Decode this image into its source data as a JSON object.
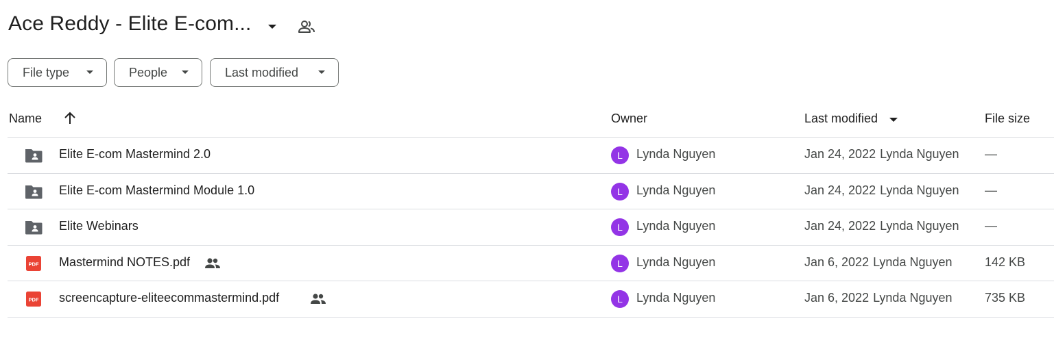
{
  "header": {
    "title": "Ace Reddy - Elite E-com...",
    "title_caret_icon": "caret-down-icon",
    "share_icon": "people-outline-icon"
  },
  "filters": [
    {
      "label": "File type"
    },
    {
      "label": "People"
    },
    {
      "label": "Last modified"
    }
  ],
  "columns": {
    "name": "Name",
    "owner": "Owner",
    "last_modified": "Last modified",
    "file_size": "File size",
    "sort_icon": "arrow-up-icon"
  },
  "colors": {
    "avatar_bg": "#9334e6",
    "folder_icon": "#5f6368",
    "pdf_icon": "#ea4335",
    "divider": "#dadce0"
  },
  "rows": [
    {
      "type": "shared-folder",
      "icon": "shared-folder-icon",
      "name": "Elite E-com Mastermind 2.0",
      "shared": false,
      "owner_initial": "L",
      "owner": "Lynda Nguyen",
      "modified_date": "Jan 24, 2022",
      "modified_by": "Lynda Nguyen",
      "size": "—"
    },
    {
      "type": "shared-folder",
      "icon": "shared-folder-icon",
      "name": "Elite E-com Mastermind Module 1.0",
      "shared": false,
      "owner_initial": "L",
      "owner": "Lynda Nguyen",
      "modified_date": "Jan 24, 2022",
      "modified_by": "Lynda Nguyen",
      "size": "—"
    },
    {
      "type": "shared-folder",
      "icon": "shared-folder-icon",
      "name": "Elite Webinars",
      "shared": false,
      "owner_initial": "L",
      "owner": "Lynda Nguyen",
      "modified_date": "Jan 24, 2022",
      "modified_by": "Lynda Nguyen",
      "size": "—"
    },
    {
      "type": "pdf",
      "icon": "pdf-icon",
      "name": "Mastermind NOTES.pdf",
      "shared": true,
      "owner_initial": "L",
      "owner": "Lynda Nguyen",
      "modified_date": "Jan 6, 2022",
      "modified_by": "Lynda Nguyen",
      "size": "142 KB"
    },
    {
      "type": "pdf",
      "icon": "pdf-icon",
      "name": "screencapture-eliteecommastermind.pdf",
      "shared": true,
      "owner_initial": "L",
      "owner": "Lynda Nguyen",
      "modified_date": "Jan 6, 2022",
      "modified_by": "Lynda Nguyen",
      "size": "735 KB"
    }
  ]
}
